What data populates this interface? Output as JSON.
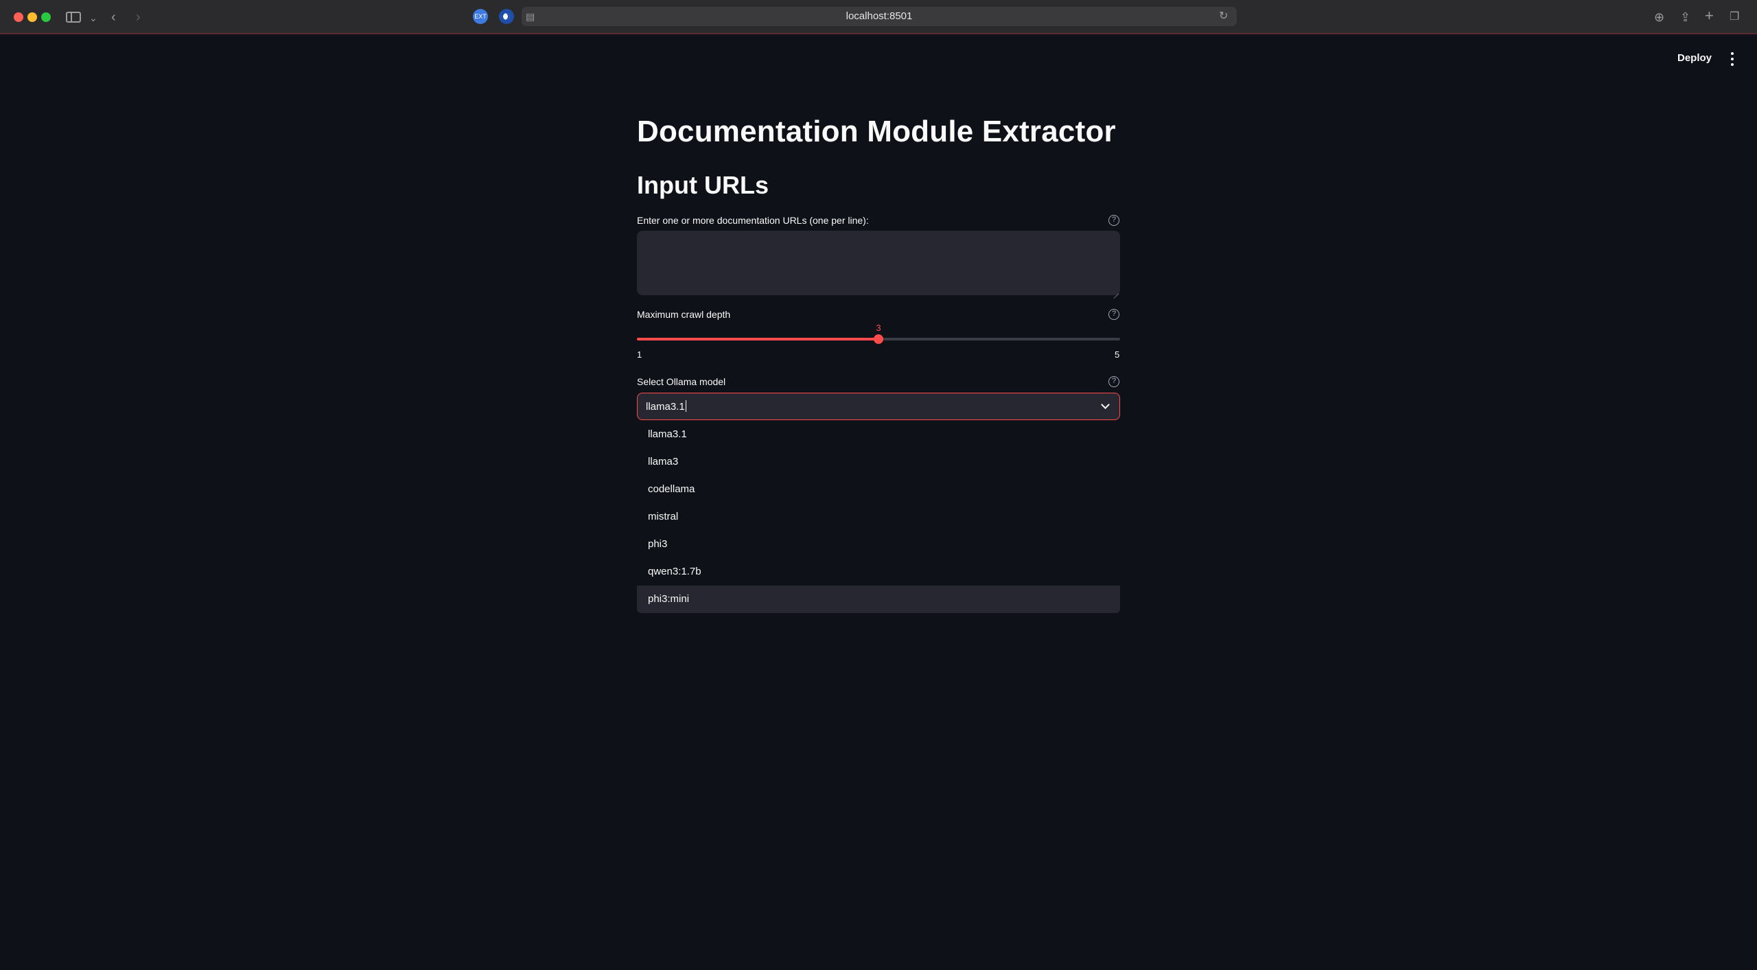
{
  "browser": {
    "url": "localhost:8501",
    "extension_badge": "EXT"
  },
  "header": {
    "deploy_label": "Deploy"
  },
  "main": {
    "title": "Documentation Module Extractor",
    "subheader": "Input URLs",
    "urls_field": {
      "label": "Enter one or more documentation URLs (one per line):",
      "value": ""
    },
    "depth_slider": {
      "label": "Maximum crawl depth",
      "min": "1",
      "max": "5",
      "value": "3",
      "fraction": 0.5
    },
    "model_select": {
      "label": "Select Ollama model",
      "value": "llama3.1",
      "options": [
        "llama3.1",
        "llama3",
        "codellama",
        "mistral",
        "phi3",
        "qwen3:1.7b",
        "phi3:mini"
      ],
      "highlighted": "phi3:mini"
    }
  },
  "colors": {
    "accent": "#ff4b4b",
    "background": "#0e1117",
    "input_bg": "#262730"
  }
}
